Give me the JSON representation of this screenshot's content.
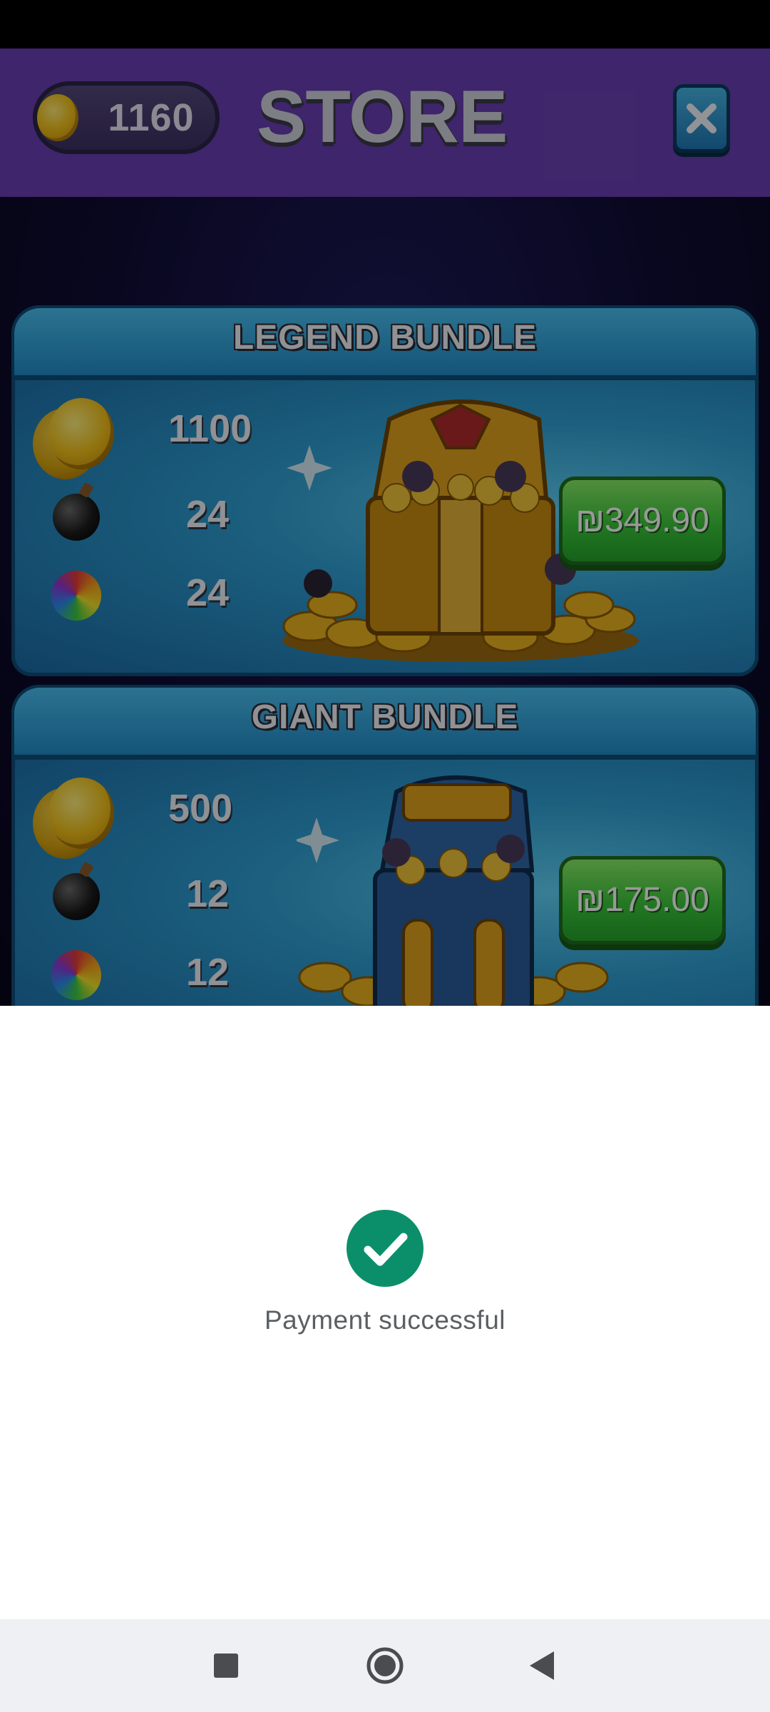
{
  "header": {
    "coin_count": "1160",
    "title": "STORE",
    "close_icon": "close-icon"
  },
  "bundles": [
    {
      "title": "LEGEND BUNDLE",
      "coins": "1100",
      "bombs": "24",
      "candies": "24",
      "price": "₪349.90"
    },
    {
      "title": "GIANT BUNDLE",
      "coins": "500",
      "bombs": "12",
      "candies": "12",
      "price": "₪175.00"
    }
  ],
  "payment_sheet": {
    "icon": "check-circle-icon",
    "message": "Payment successful",
    "accent": "#0b8f6a"
  },
  "navigation_bar": {
    "buttons": [
      "recents-icon",
      "home-icon",
      "back-icon"
    ]
  }
}
